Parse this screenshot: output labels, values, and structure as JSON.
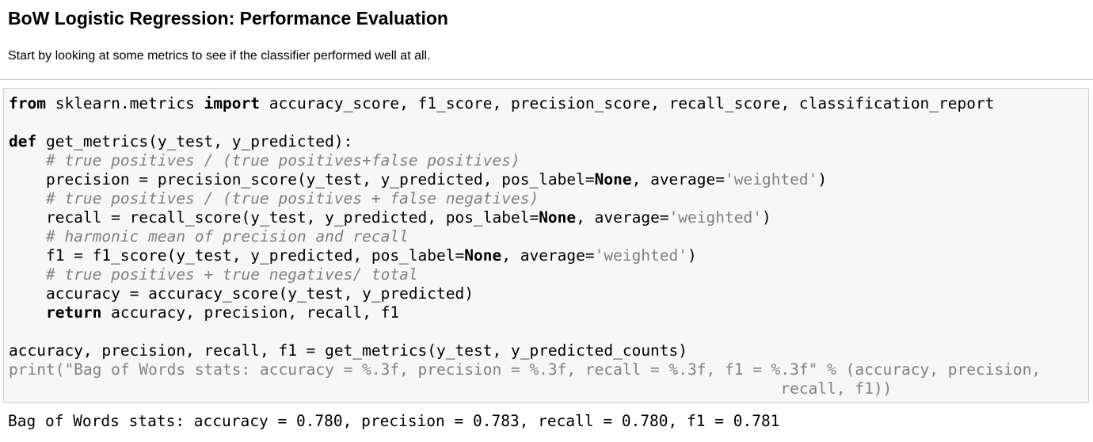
{
  "markdown": {
    "heading": "BoW Logistic Regression: Performance Evaluation",
    "paragraph": "Start by looking at some metrics to see if the classifier performed well at all."
  },
  "code": {
    "l1_kw1": "from",
    "l1_a": " sklearn.metrics ",
    "l1_kw2": "import",
    "l1_b": " accuracy_score, f1_score, precision_score, recall_score, classification_report",
    "l3_kw": "def",
    "l3_a": " get_metrics(y_test, y_predicted):",
    "l4_cm": "    # true positives / (true positives+false positives)",
    "l5_a": "    precision = precision_score(y_test, y_predicted, pos_label=",
    "l5_none": "None",
    "l5_b": ", average=",
    "l5_str": "'weighted'",
    "l5_c": ")",
    "l6_cm": "    # true positives / (true positives + false negatives)",
    "l7_a": "    recall = recall_score(y_test, y_predicted, pos_label=",
    "l7_none": "None",
    "l7_b": ", average=",
    "l7_str": "'weighted'",
    "l7_c": ")",
    "l8_cm": "    # harmonic mean of precision and recall",
    "l9_a": "    f1 = f1_score(y_test, y_predicted, pos_label=",
    "l9_none": "None",
    "l9_b": ", average=",
    "l9_str": "'weighted'",
    "l9_c": ")",
    "l10_cm": "    # true positives + true negatives/ total",
    "l11_a": "    accuracy = accuracy_score(y_test, y_predicted)",
    "l12_ind": "    ",
    "l12_kw": "return",
    "l12_a": " accuracy, precision, recall, f1",
    "l14_a": "accuracy, precision, recall, f1 = get_metrics(y_test, y_predicted_counts)",
    "l15_a": "print(\"Bag of Words stats: accuracy = %.3f, precision = %.3f, recall = %.3f, f1 = %.3f\" % (accuracy, precision,",
    "l16_a": "                                                                                   recall, f1))"
  },
  "output": {
    "text": "Bag of Words stats: accuracy = 0.780, precision = 0.783, recall = 0.780, f1 = 0.781"
  }
}
